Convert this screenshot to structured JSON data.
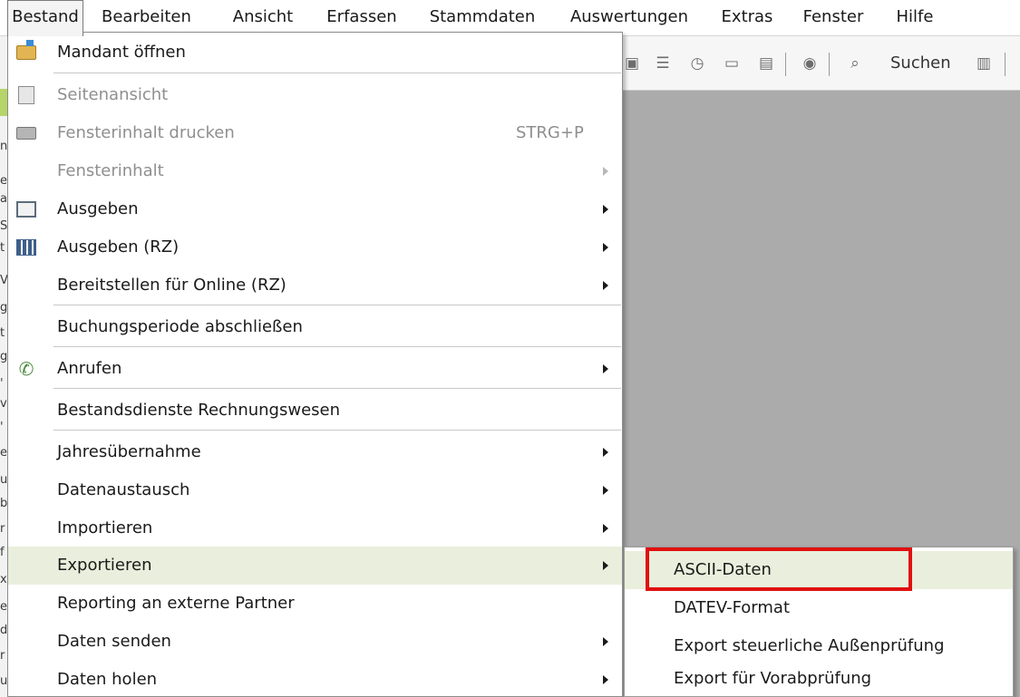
{
  "menubar": {
    "items": [
      {
        "label": "Bestand"
      },
      {
        "label": "Bearbeiten"
      },
      {
        "label": "Ansicht"
      },
      {
        "label": "Erfassen"
      },
      {
        "label": "Stammdaten"
      },
      {
        "label": "Auswertungen"
      },
      {
        "label": "Extras"
      },
      {
        "label": "Fenster"
      },
      {
        "label": "Hilfe"
      }
    ]
  },
  "toolbar": {
    "search_label": "Suchen"
  },
  "left_strip": {
    "chars": [
      "n",
      "e",
      "a",
      "S",
      "t",
      "V",
      "g",
      "t",
      "g",
      "'",
      "v",
      "'",
      "e",
      "u",
      "b",
      "r",
      "f",
      "x",
      "e",
      "d",
      "r",
      "u"
    ]
  },
  "menu": {
    "items": [
      {
        "label": "Mandant öffnen",
        "icon": "folder-icon"
      },
      {
        "label": "Seitenansicht",
        "icon": "page-preview-icon",
        "disabled": true
      },
      {
        "label": "Fensterinhalt drucken",
        "icon": "printer-icon",
        "disabled": true,
        "shortcut": "STRG+P"
      },
      {
        "label": "Fensterinhalt",
        "disabled": true,
        "submenu": true
      },
      {
        "label": "Ausgeben",
        "icon": "output-icon",
        "submenu": true
      },
      {
        "label": "Ausgeben (RZ)",
        "icon": "output-rz-icon",
        "submenu": true
      },
      {
        "label": "Bereitstellen für Online (RZ)",
        "submenu": true
      },
      {
        "label": "Buchungsperiode abschließen"
      },
      {
        "label": "Anrufen",
        "icon": "phone-icon",
        "submenu": true
      },
      {
        "label": "Bestandsdienste Rechnungswesen"
      },
      {
        "label": "Jahresübernahme",
        "submenu": true
      },
      {
        "label": "Datenaustausch",
        "submenu": true
      },
      {
        "label": "Importieren",
        "submenu": true
      },
      {
        "label": "Exportieren",
        "submenu": true,
        "highlighted": true
      },
      {
        "label": "Reporting an externe Partner"
      },
      {
        "label": "Daten senden",
        "submenu": true
      },
      {
        "label": "Daten holen",
        "submenu": true
      }
    ]
  },
  "submenu": {
    "items": [
      {
        "label": "ASCII-Daten",
        "highlighted": true
      },
      {
        "label": "DATEV-Format"
      },
      {
        "label": "Export steuerliche Außenprüfung"
      },
      {
        "label": "Export für Vorabprüfung"
      }
    ]
  },
  "colors": {
    "highlight_bg": "#e9efdc",
    "annotation_red": "#e01010",
    "workspace_gray": "#ababab",
    "strip_green": "#b5d56a"
  }
}
